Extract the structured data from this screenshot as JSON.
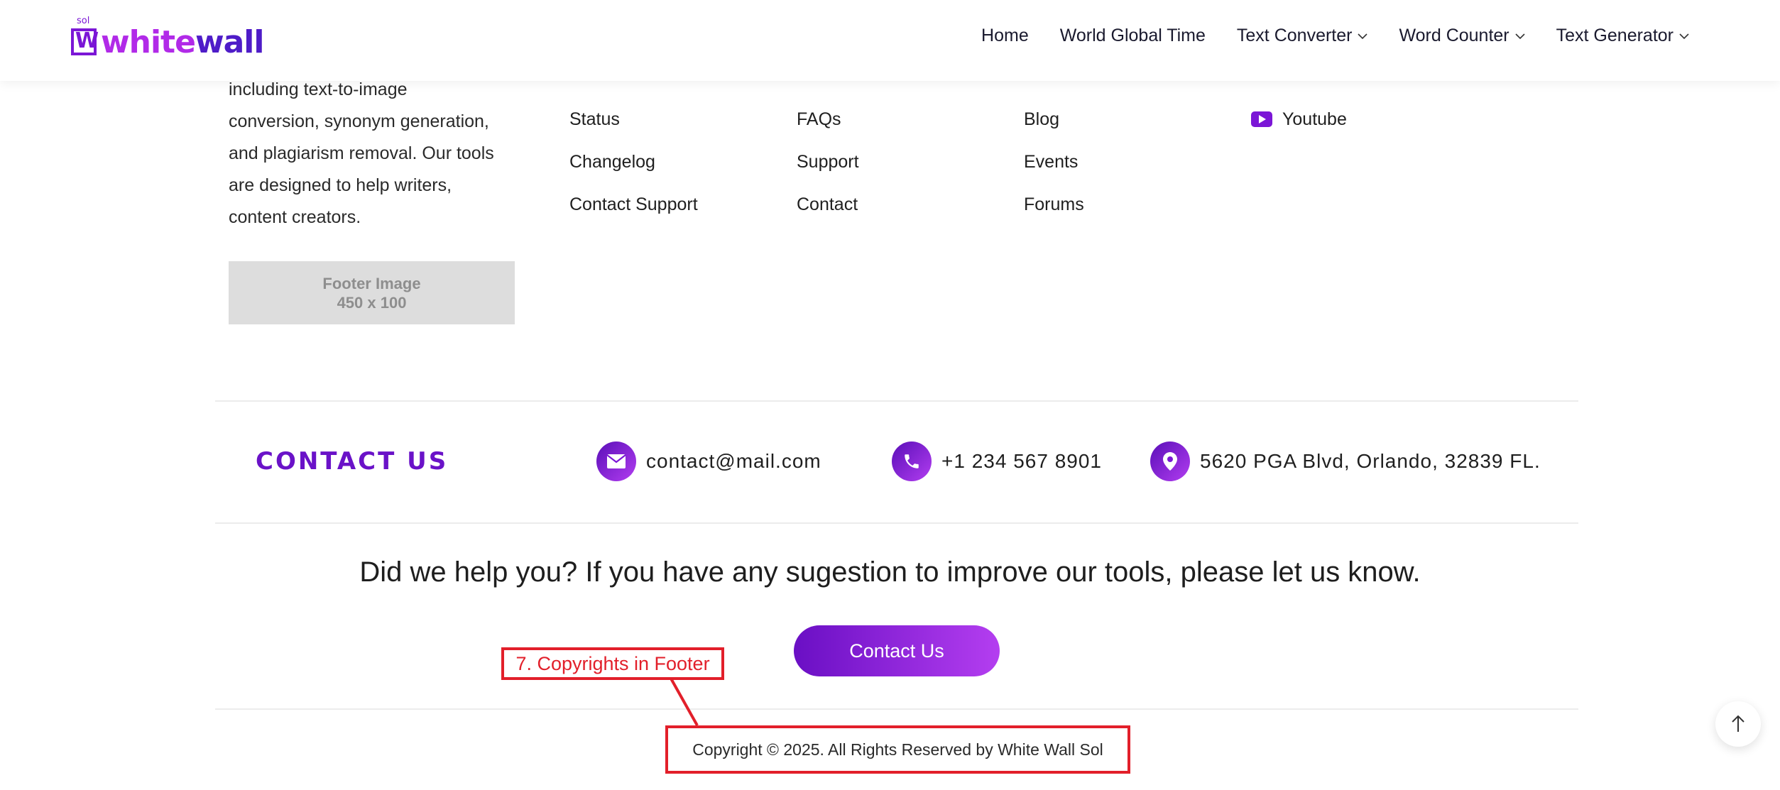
{
  "header": {
    "logo_small": "sol",
    "logo_part1": "white",
    "logo_part2": "wall",
    "nav": [
      {
        "label": "Home"
      },
      {
        "label": "World Global Time"
      },
      {
        "label": "Text Converter"
      },
      {
        "label": "Word Counter"
      },
      {
        "label": "Text Generator"
      }
    ]
  },
  "about": {
    "lines": [
      "including text-to-image",
      "conversion, synonym generation,",
      "and plagiarism removal. Our tools",
      "are designed to help writers,",
      "content creators."
    ],
    "image_line1": "Footer Image",
    "image_line2": "450 x 100"
  },
  "columns": {
    "col1": [
      "Status",
      "Changelog",
      "Contact Support"
    ],
    "col2": [
      "FAQs",
      "Support",
      "Contact"
    ],
    "col3": [
      "Blog",
      "Events",
      "Forums"
    ],
    "social": {
      "label": "Youtube"
    }
  },
  "contact": {
    "title": "CONTACT US",
    "email": "contact@mail.com",
    "phone": "+1 234 567 8901",
    "address": "5620 PGA Blvd, Orlando, 32839 FL."
  },
  "help_text": "Did we help you? If you have any sugestion to improve our tools, please let us know.",
  "contact_button": "Contact Us",
  "annotation_label": "7. Copyrights in Footer",
  "copyright": "Copyright © 2025. All Rights Reserved by White Wall Sol",
  "colors": {
    "accent": "#7b16d6",
    "annotation": "#e21f2a"
  }
}
